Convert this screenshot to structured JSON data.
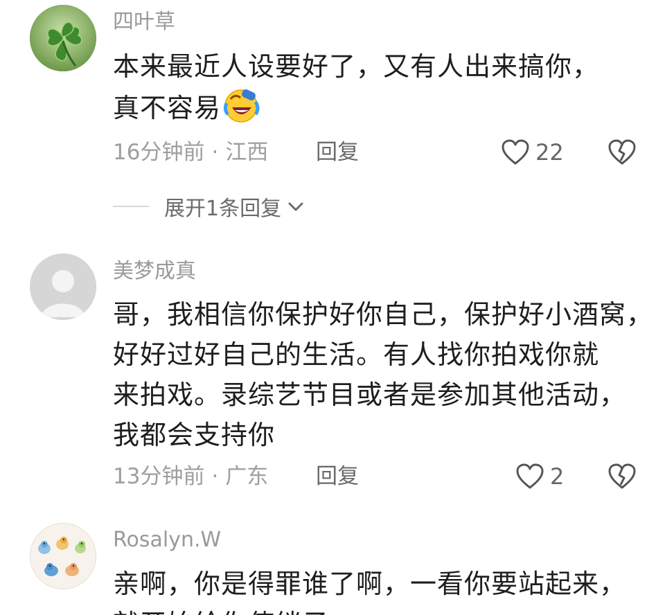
{
  "comments": [
    {
      "username": "四叶草",
      "avatar_icon": "four-leaf-clover-icon",
      "body_lines": [
        "本来最近人设要好了，又有人出来搞你，",
        "真不容易"
      ],
      "emoji_icon": "laughing-crying-emoji-icon",
      "time": "16分钟前",
      "location": "江西",
      "reply_label": "回复",
      "like_count": "22",
      "expand_label": "展开1条回复"
    },
    {
      "username": "美梦成真",
      "avatar_icon": "default-avatar-icon",
      "body_lines": [
        "哥，我相信你保护好你自己，保护好小酒窝，",
        "好好过好自己的生活。有人找你拍戏你就",
        "来拍戏。录综艺节目或者是参加其他活动，",
        "我都会支持你"
      ],
      "time": "13分钟前",
      "location": "广东",
      "reply_label": "回复",
      "like_count": "2"
    },
    {
      "username": "Rosalyn.W",
      "avatar_icon": "birds-illustration-avatar-icon",
      "body_lines": [
        "亲啊，你是得罪谁了啊，一看你要站起来，",
        "就开始给你使绊子"
      ]
    }
  ],
  "separator": "·",
  "colors": {
    "username": "#9a9a9a",
    "body": "#1e1e1e",
    "meta": "#9e9e9e",
    "icon_stroke": "#555555"
  }
}
